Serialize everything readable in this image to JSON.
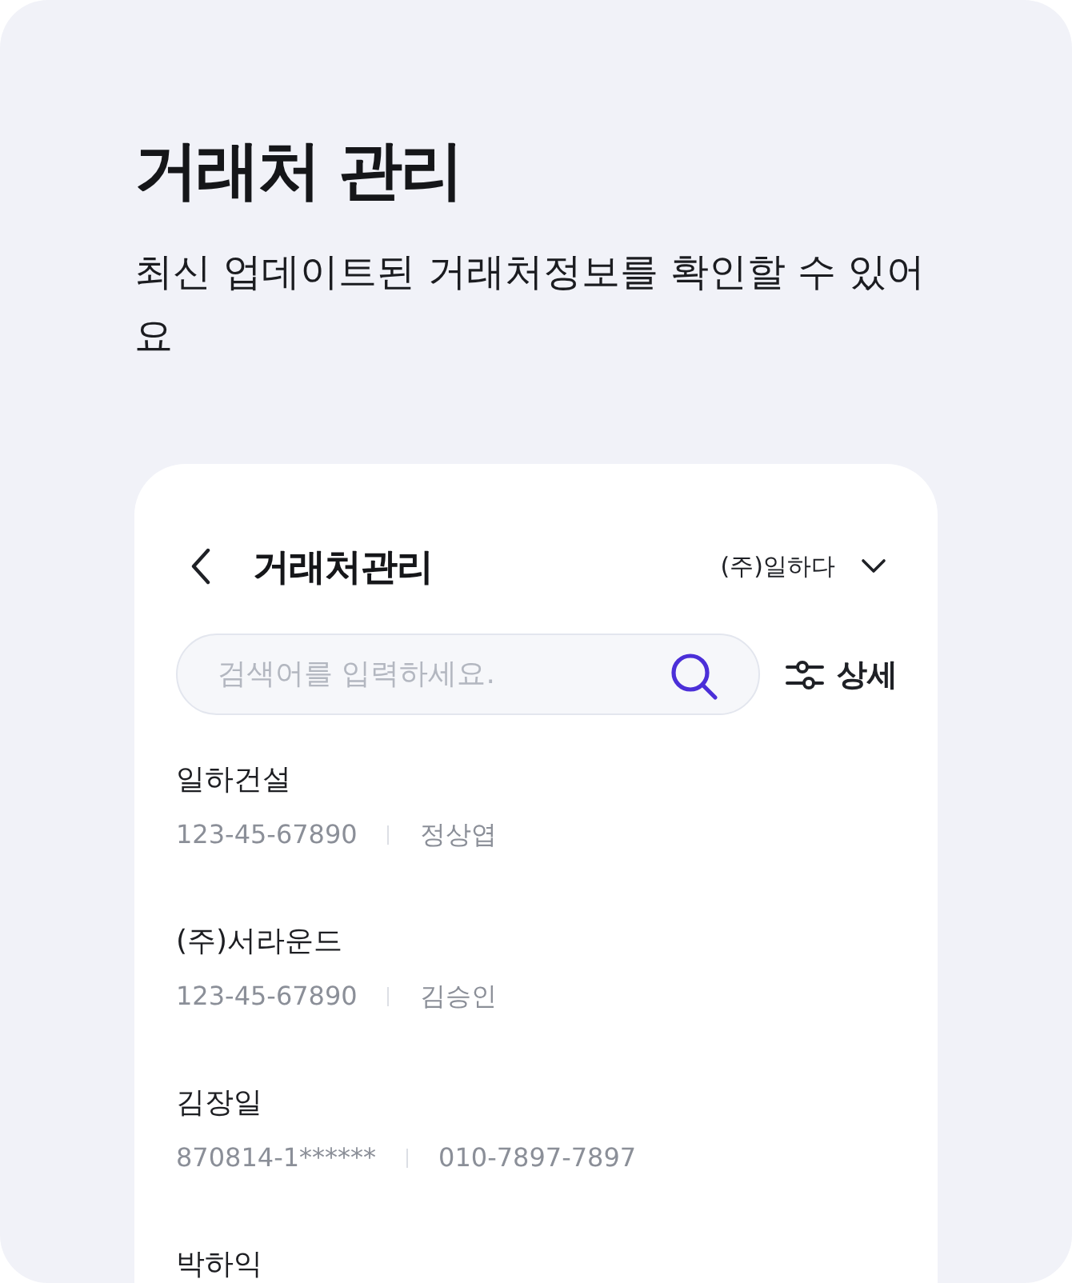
{
  "page": {
    "title": "거래처 관리",
    "subtitle": "최신 업데이트된 거래처정보를 확인할 수 있어요"
  },
  "app": {
    "title": "거래처관리",
    "company": "(주)일하다",
    "search": {
      "placeholder": "검색어를 입력하세요."
    },
    "filter_button": "상세",
    "partners": [
      {
        "name": "일하건설",
        "registration_number": "123-45-67890",
        "contact": "정상엽"
      },
      {
        "name": "(주)서라운드",
        "registration_number": "123-45-67890",
        "contact": "김승인"
      },
      {
        "name": "김장일",
        "registration_number": "870814-1******",
        "contact": "010-7897-7897"
      },
      {
        "name": "박하익"
      }
    ]
  }
}
